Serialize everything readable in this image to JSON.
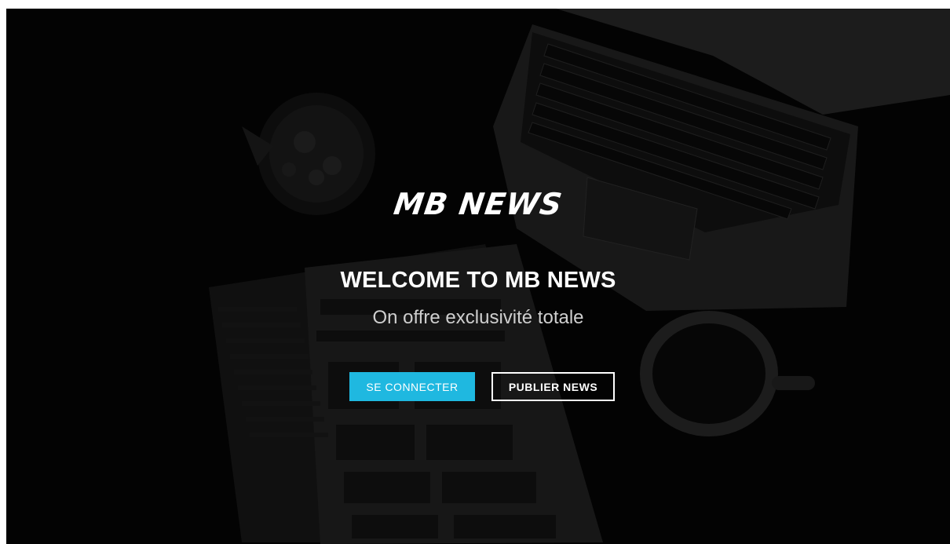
{
  "brand": {
    "logo_text": "MB NEWS"
  },
  "hero": {
    "title": "WELCOME TO MB NEWS",
    "subtitle": "On offre exclusivité totale"
  },
  "actions": {
    "login_label": "SE CONNECTER",
    "publish_label": "PUBLIER NEWS"
  },
  "colors": {
    "accent": "#1fb8e0",
    "background": "#050505",
    "text": "#ffffff"
  }
}
